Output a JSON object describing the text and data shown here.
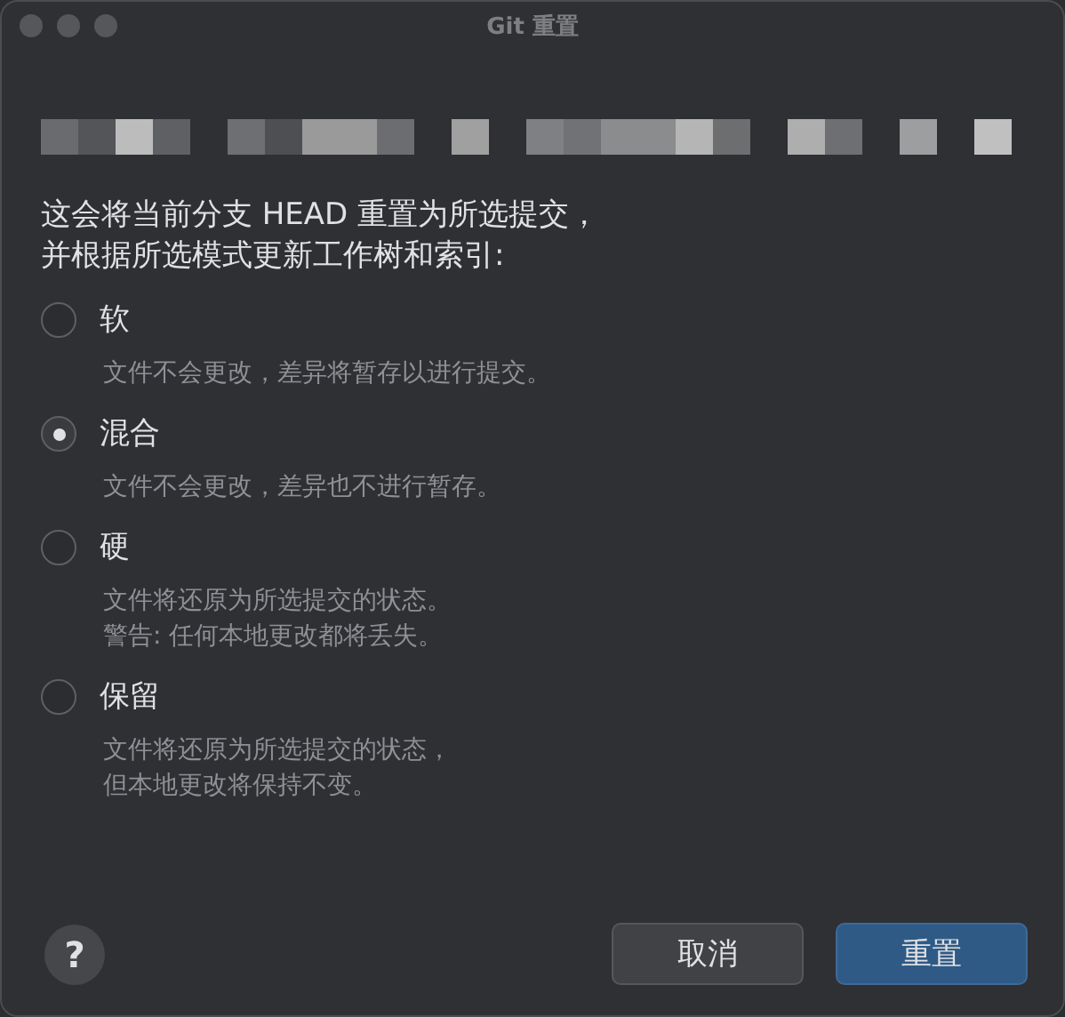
{
  "window": {
    "title": "Git 重置"
  },
  "description": [
    "这会将当前分支 HEAD 重置为所选提交，",
    "并根据所选模式更新工作树和索引:"
  ],
  "modes": [
    {
      "label": "软",
      "selected": false,
      "details": [
        "文件不会更改，差异将暂存以进行提交。"
      ]
    },
    {
      "label": "混合",
      "selected": true,
      "details": [
        "文件不会更改，差异也不进行暂存。"
      ]
    },
    {
      "label": "硬",
      "selected": false,
      "details": [
        "文件将还原为所选提交的状态。",
        "警告: 任何本地更改都将丢失。"
      ]
    },
    {
      "label": "保留",
      "selected": false,
      "details": [
        "文件将还原为所选提交的状态，",
        "但本地更改将保持不变。"
      ]
    }
  ],
  "help_button": "?",
  "buttons": [
    {
      "label": "取消",
      "kind": "secondary"
    },
    {
      "label": "重置",
      "kind": "primary"
    }
  ]
}
